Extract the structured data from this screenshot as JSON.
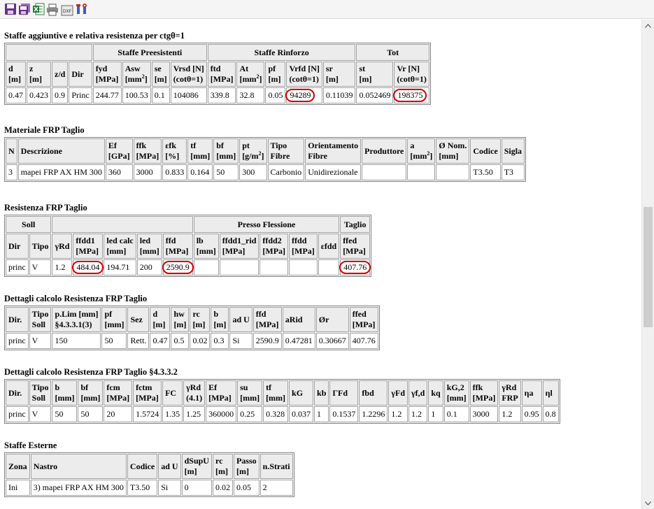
{
  "toolbar": {
    "buttons": [
      "save-icon",
      "save-all-icon",
      "excel-export-icon",
      "print-icon",
      "dxf-export-icon",
      "settings-icon"
    ]
  },
  "s1": {
    "title": "Staffe aggiuntive e relativa resistenza per ctgθ=1",
    "groups": [
      "Staffe Preesistenti",
      "Staffe Rinforzo",
      "Tot"
    ],
    "headers": [
      [
        "d",
        "[m]"
      ],
      [
        "z",
        "[m]"
      ],
      [
        "z/d"
      ],
      [
        "Dir"
      ],
      [
        "fyd",
        "[MPa]"
      ],
      [
        "Asw",
        "[mm2]"
      ],
      [
        "se",
        "[m]"
      ],
      [
        "Vrsd [N]",
        "(cotθ=1)"
      ],
      [
        "ftd",
        "[MPa]"
      ],
      [
        "At",
        "[mm2]"
      ],
      [
        "pf",
        "[m]"
      ],
      [
        "Vrfd [N]",
        "(cotθ=1)"
      ],
      [
        "sr",
        "[m]"
      ],
      [
        "st",
        "[m]"
      ],
      [
        "Vr [N]",
        "(cotθ=1)"
      ]
    ],
    "row": [
      "0.47",
      "0.423",
      "0.9",
      "Princ",
      "244.77",
      "100.53",
      "0.1",
      "104086",
      "339.8",
      "32.8",
      "0.05",
      "94289",
      "0.11039",
      "0.052469",
      "198375"
    ],
    "circled": [
      11,
      14
    ]
  },
  "s2": {
    "title": "Materiale FRP Taglio",
    "headers": [
      [
        "N"
      ],
      [
        "Descrizione"
      ],
      [
        "Ef",
        "[GPa]"
      ],
      [
        "ffk",
        "[MPa]"
      ],
      [
        "εfk",
        "[%]"
      ],
      [
        "tf",
        "[mm]"
      ],
      [
        "bf",
        "[mm]"
      ],
      [
        "pt",
        "[g/m2]"
      ],
      [
        "Tipo",
        "Fibre"
      ],
      [
        "Orientamento",
        "Fibre"
      ],
      [
        "Produttore"
      ],
      [
        "a",
        "[mm2]"
      ],
      [
        "Ø Nom.",
        "[mm]"
      ],
      [
        "Codice"
      ],
      [
        "Sigla"
      ]
    ],
    "row": [
      "3",
      "mapei FRP AX HM 300",
      "360",
      "3000",
      "0.833",
      "0.164",
      "50",
      "300",
      "Carbonio",
      "Unidirezionale",
      "",
      "",
      "",
      "T3.50",
      "T3"
    ]
  },
  "s3": {
    "title": "Resistenza FRP Taglio",
    "groups": [
      "Soll",
      "",
      "Presso Flessione",
      "Taglio"
    ],
    "headers": [
      [
        "Dir"
      ],
      [
        "Tipo"
      ],
      [
        "γRd"
      ],
      [
        "ffdd1",
        "[MPa]"
      ],
      [
        "led calc",
        "[mm]"
      ],
      [
        "led",
        "[mm]"
      ],
      [
        "ffd",
        "[MPa]"
      ],
      [
        "lb",
        "[mm]"
      ],
      [
        "ffdd1_rid",
        "[MPa]"
      ],
      [
        "ffdd2",
        "[MPa]"
      ],
      [
        "ffdd",
        "[MPa]"
      ],
      [
        "εfdd"
      ],
      [
        "ffed",
        "[MPa]"
      ]
    ],
    "row": [
      "princ",
      "V",
      "1.2",
      "484.04",
      "194.71",
      "200",
      "2590.9",
      "",
      "",
      "",
      "",
      "",
      "407.76"
    ],
    "circled": [
      3,
      6,
      12
    ]
  },
  "s4": {
    "title": "Dettagli calcolo Resistenza FRP Taglio",
    "headers": [
      [
        "Dir."
      ],
      [
        "Tipo",
        "Soll"
      ],
      [
        "p.Lim [mm]",
        "§4.3.3.1(3)"
      ],
      [
        "pf",
        "[mm]"
      ],
      [
        "Sez"
      ],
      [
        "d",
        "[m]"
      ],
      [
        "hw",
        "[m]"
      ],
      [
        "rc",
        "[m]"
      ],
      [
        "b",
        "[m]"
      ],
      [
        "ad U"
      ],
      [
        "ffd",
        "[MPa]"
      ],
      [
        "aRid"
      ],
      [
        "Ør"
      ],
      [
        "ffed",
        "[MPa]"
      ]
    ],
    "row": [
      "princ",
      "V",
      "150",
      "50",
      "Rett.",
      "0.47",
      "0.5",
      "0.02",
      "0.3",
      "Si",
      "2590.9",
      "0.47281",
      "0.30667",
      "407.76"
    ]
  },
  "s5": {
    "title": "Dettagli calcolo Resistenza FRP Taglio §4.3.3.2",
    "headers": [
      [
        "Dir."
      ],
      [
        "Tipo",
        "Soll"
      ],
      [
        "b",
        "[mm]"
      ],
      [
        "bf",
        "[mm]"
      ],
      [
        "fcm",
        "[MPa]"
      ],
      [
        "fctm",
        "[MPa]"
      ],
      [
        "FC"
      ],
      [
        "γRd",
        "(4.1)"
      ],
      [
        "Ef",
        "[MPa]"
      ],
      [
        "su",
        "[mm]"
      ],
      [
        "tf",
        "[mm]"
      ],
      [
        "kG"
      ],
      [
        "kb"
      ],
      [
        "ΓFd"
      ],
      [
        "fbd"
      ],
      [
        "γFd"
      ],
      [
        "γf,d"
      ],
      [
        "kq"
      ],
      [
        "kG,2",
        "[mm]"
      ],
      [
        "ffk",
        "[MPa]"
      ],
      [
        "γRd",
        "FRP"
      ],
      [
        "ηa"
      ],
      [
        "ηl"
      ]
    ],
    "row": [
      "princ",
      "V",
      "50",
      "50",
      "20",
      "1.5724",
      "1.35",
      "1.25",
      "360000",
      "0.25",
      "0.328",
      "0.037",
      "1",
      "0.1537",
      "1.2296",
      "1.2",
      "1.2",
      "1",
      "0.1",
      "3000",
      "1.2",
      "0.95",
      "0.8"
    ]
  },
  "s6": {
    "title": "Staffe Esterne",
    "headers": [
      [
        "Zona"
      ],
      [
        "Nastro"
      ],
      [
        "Codice"
      ],
      [
        "ad U"
      ],
      [
        "dSupU",
        "[m]"
      ],
      [
        "rc",
        "[m]"
      ],
      [
        "Passo",
        "[m]"
      ],
      [
        "n.Strati"
      ]
    ],
    "row": [
      "Ini",
      "3) mapei FRP AX HM 300",
      "T3.50",
      "Si",
      "0",
      "0.02",
      "0.05",
      "2"
    ]
  }
}
